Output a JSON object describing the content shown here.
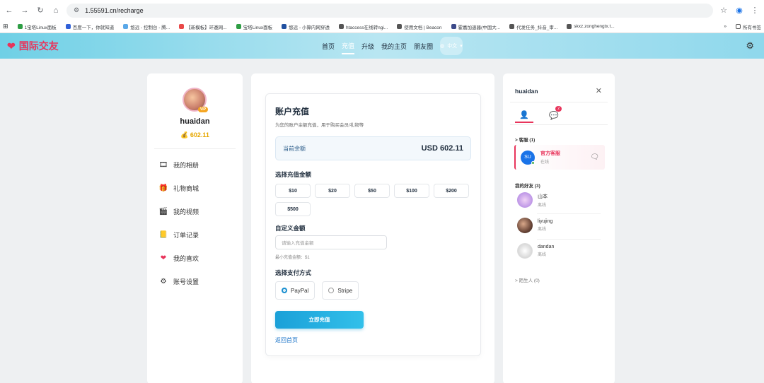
{
  "browser": {
    "url": "1.55591.cn/recharge",
    "bookmarks": [
      "1宝塔Linux面板",
      "百度一下，你就知道",
      "悠远 - 控制台 - 腾...",
      "【新模板】环邀网...",
      "宝塔Linux面板",
      "悠远 - 小算内网穿透",
      "htaccess在线转ngi...",
      "使用文档 | Beacon",
      "霍嘉加速器(中国大...",
      "代发任务_抖音_审...",
      "skxz.zonghengtx.t..."
    ],
    "all_bookmarks": "所有书签"
  },
  "header": {
    "logo": "国际交友",
    "nav": [
      "首页",
      "充值",
      "升级",
      "我的主页",
      "朋友圈"
    ],
    "lang": "中文"
  },
  "profile": {
    "vip": "VIP",
    "username": "huaidan",
    "balance": "602.11",
    "menu": [
      {
        "label": "我的相册",
        "icon": "album-icon"
      },
      {
        "label": "礼物商城",
        "icon": "gift-icon"
      },
      {
        "label": "我的视频",
        "icon": "video-icon"
      },
      {
        "label": "订单记录",
        "icon": "order-icon"
      },
      {
        "label": "我的喜欢",
        "icon": "heart-icon"
      },
      {
        "label": "账号设置",
        "icon": "settings-icon"
      }
    ]
  },
  "recharge": {
    "title": "账户充值",
    "subtitle": "为您的账户余额充值，用于购买会员/礼物等",
    "balance_label": "当前余额",
    "balance_value": "USD 602.11",
    "amount_title": "选择充值金额",
    "amounts": [
      "$10",
      "$20",
      "$50",
      "$100",
      "$200",
      "$500"
    ],
    "custom_title": "自定义金额",
    "custom_placeholder": "请输入充值金额",
    "min_note": "最小充值金额：$1",
    "payment_title": "选择支付方式",
    "payments": [
      {
        "label": "PayPal",
        "selected": true
      },
      {
        "label": "Stripe",
        "selected": false
      }
    ],
    "submit": "立即充值",
    "back": "返回首页"
  },
  "chat": {
    "username": "huaidan",
    "badge": "2",
    "service_group": "> 客服 (1)",
    "service": {
      "initials": "SU",
      "name": "官方客服",
      "status": "在线"
    },
    "friends_group": "我的好友 (3)",
    "friends": [
      {
        "name": "山本",
        "status": "离线"
      },
      {
        "name": "liyujing",
        "status": "离线"
      },
      {
        "name": "dandan",
        "status": "离线"
      }
    ],
    "strangers_group": "> 陌生人 (0)"
  }
}
